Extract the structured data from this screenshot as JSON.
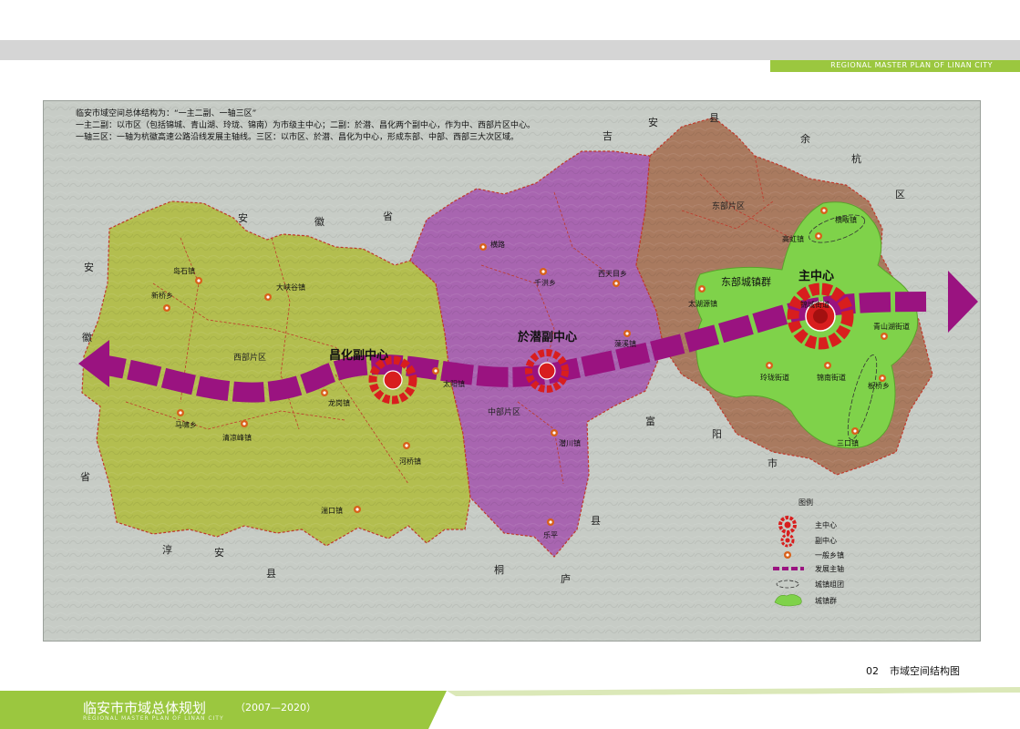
{
  "header": {
    "english_title": "REGIONAL MASTER PLAN OF LINAN CITY"
  },
  "intro": {
    "line1": "临安市域空间总体结构为：“一主二副、一轴三区”",
    "line2": "一主二副：以市区（包括锦城、青山湖、玲珑、锦南）为市级主中心；二副：於潜、昌化两个副中心，作为中、西部片区中心。",
    "line3": "一轴三区：一轴为杭徽高速公路沿线发展主轴线。三区：以市区、於潜、昌化为中心，形成东部、中部、西部三大次区域。"
  },
  "province_chars": {
    "anhui_n1": "安",
    "anhui_n2": "徽",
    "anhui_n3": "省",
    "anhui_w1": "安",
    "anhui_w2": "徽",
    "anhui_w3": "省",
    "anji1": "安",
    "anji2": "吉",
    "anji3": "县",
    "yuhang1": "余",
    "yuhang2": "杭",
    "yuhang3": "区",
    "fuyang1": "富",
    "fuyang2": "阳",
    "fuyang3": "市",
    "tonglu1": "桐",
    "tonglu2": "庐",
    "tonglu3": "县",
    "chunan1": "淳",
    "chunan2": "安",
    "chunan3": "县"
  },
  "zones": {
    "west": "西部片区",
    "central": "中部片区",
    "east": "东部片区",
    "east_cluster": "东部城镇群"
  },
  "centers": {
    "main": "主中心",
    "yuqian": "於潜副中心",
    "changhua": "昌化副中心"
  },
  "towns": {
    "daoshi": "岛石镇",
    "xinqiao": "新桥乡",
    "daxiagu": "大峡谷镇",
    "longgang": "龙岗镇",
    "majian": "马啸乡",
    "qingliangfeng": "清凉峰镇",
    "heqiao": "河桥镇",
    "tangkou": "湍口镇",
    "henglu": "横路",
    "qianhong": "千洪乡",
    "xitianmu": "西天目乡",
    "taiyang": "太阳镇",
    "zaoxi": "藻溪镇",
    "qianchuan": "潜川镇",
    "leping": "乐平",
    "gaohong": "高虹镇",
    "hengfan": "横畈镇",
    "taihuyuan": "太湖源镇",
    "jincheng": "锦城街道",
    "qingshanhu": "青山湖街道",
    "linglong": "玲珑街道",
    "jinnan": "锦南街道",
    "banqiao": "板桥乡",
    "sankou": "三口镇"
  },
  "legend": {
    "title": "图例",
    "items": [
      {
        "label": "主中心",
        "icon": "main-center-icon"
      },
      {
        "label": "副中心",
        "icon": "sub-center-icon"
      },
      {
        "label": "一般乡镇",
        "icon": "town-icon"
      },
      {
        "label": "发展主轴",
        "icon": "axis-icon"
      },
      {
        "label": "城镇组团",
        "icon": "town-group-icon"
      },
      {
        "label": "城镇群",
        "icon": "town-cluster-icon"
      }
    ]
  },
  "colors": {
    "west": "#b4bf4f",
    "central": "#a865b0",
    "east": "#a87a60",
    "cluster": "#7fd24a",
    "axis": "#9a1380",
    "center_red": "#d81e1e",
    "footer_green": "#9bc73f"
  },
  "page": {
    "number": "02",
    "title": "市域空间结构图"
  },
  "footer": {
    "title": "临安市市域总体规划",
    "years": "（2007—2020）",
    "subtitle": "REGIONAL MASTER PLAN OF LINAN CITY"
  }
}
